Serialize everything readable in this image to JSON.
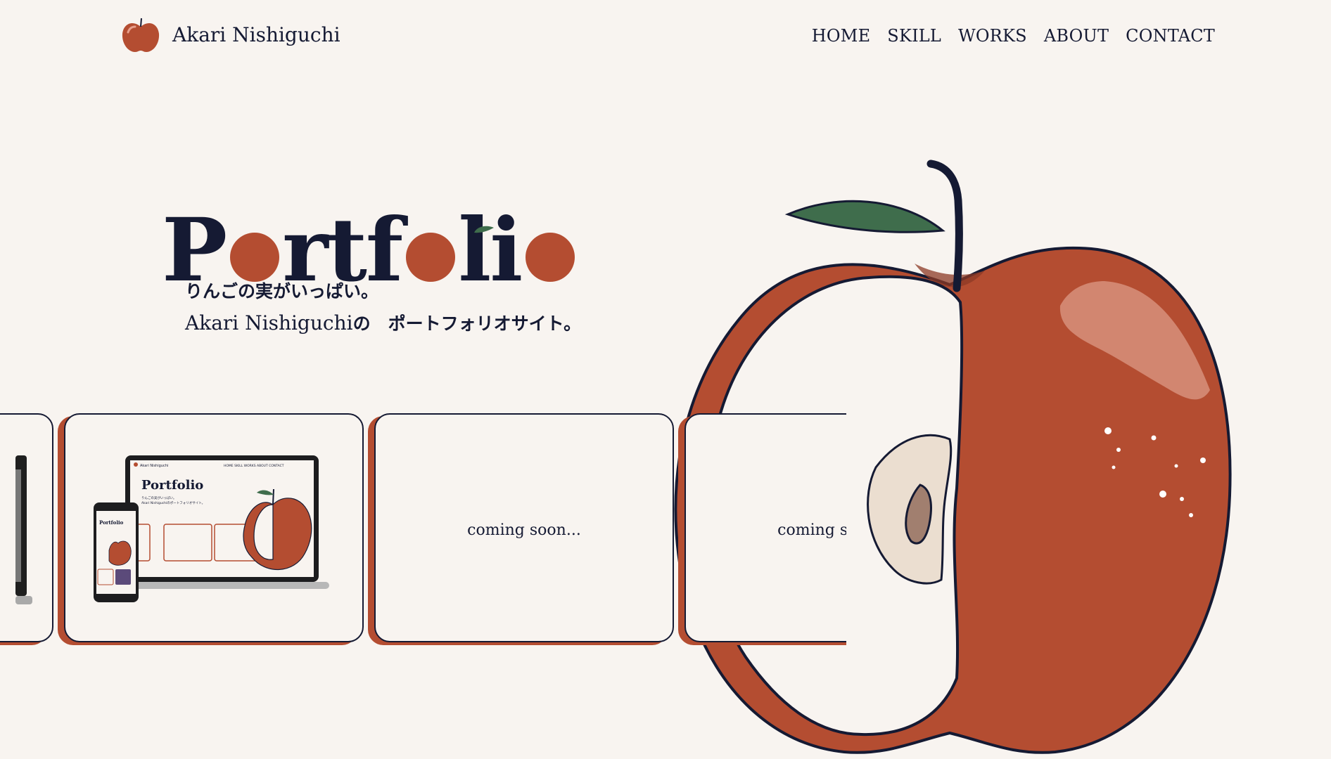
{
  "header": {
    "site_name": "Akari Nishiguchi",
    "nav": [
      "HOME",
      "SKILL",
      "WORKS",
      "ABOUT",
      "CONTACT"
    ]
  },
  "hero": {
    "title": "Portfolio",
    "title_parts": [
      "P",
      "rtf",
      "li"
    ],
    "tagline_line1": "りんごの実がいっぱい。",
    "tagline_name": "Akari Nishiguchi",
    "tagline_suffix": "の　ポートフォリオサイト。"
  },
  "works": {
    "cards": [
      {
        "type": "image",
        "label": "partial device screenshot"
      },
      {
        "type": "image",
        "label": "portfolio site mockup"
      },
      {
        "type": "text",
        "label": "coming soon..."
      },
      {
        "type": "text",
        "label": "coming soon..."
      }
    ],
    "mockup": {
      "site_name": "Akari Nishiguchi",
      "title": "Portfolio",
      "nav": "HOME SKILL WORKS ABOUT CONTACT",
      "tagline_1": "りんごの実がいっぱい。",
      "tagline_2": "Akari Nishiguchiのポートフォリオサイト。"
    }
  },
  "colors": {
    "background": "#f8f4f0",
    "ink": "#151a33",
    "apple_red": "#b44d31",
    "leaf_green": "#3f6d4c",
    "flesh": "#f8f4f0",
    "core": "#ebded0"
  }
}
